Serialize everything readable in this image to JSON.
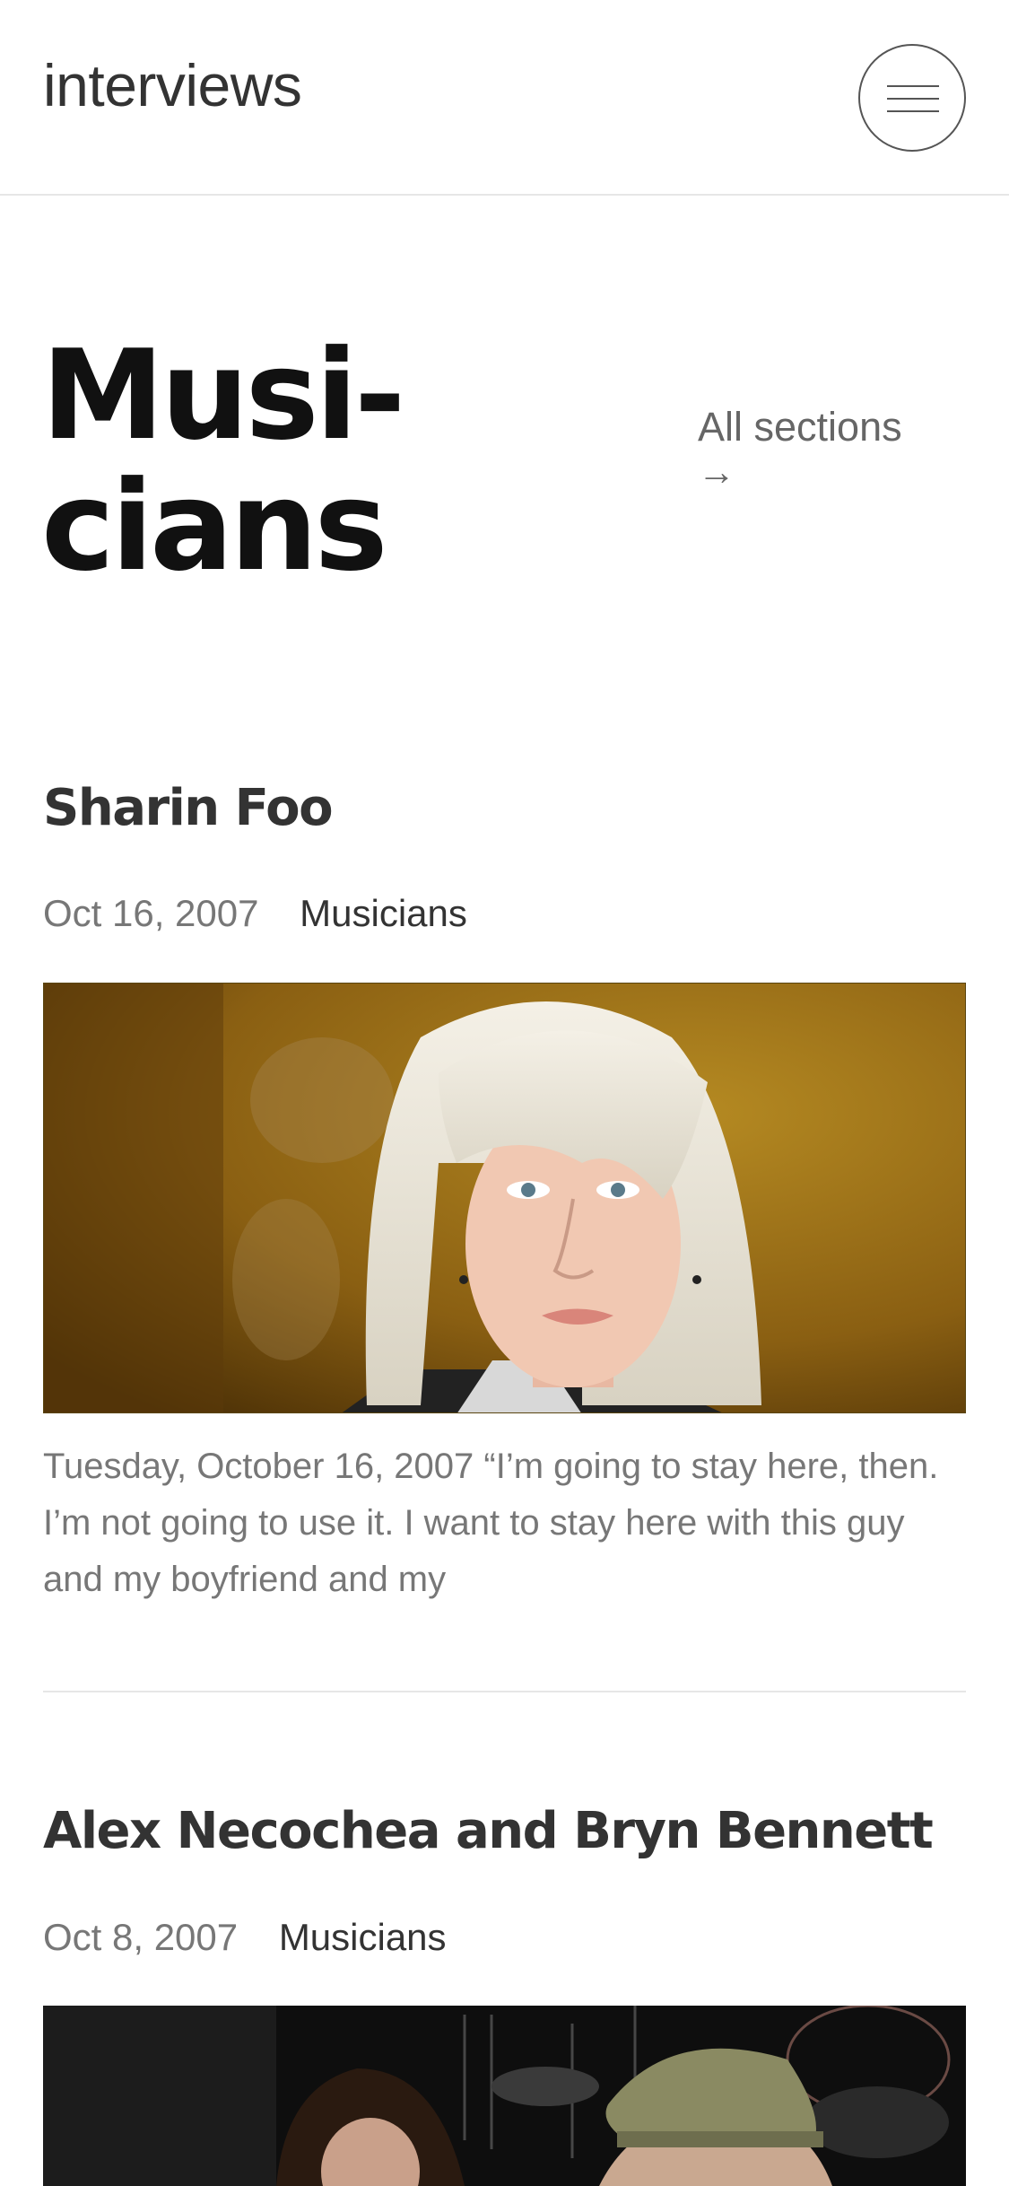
{
  "header": {
    "site_title": "interviews",
    "menu_icon": "hamburger-icon"
  },
  "section": {
    "title_line1": "Musi-",
    "title_line2": "cians",
    "all_sections_label": "All sections",
    "all_sections_arrow": "→"
  },
  "posts": [
    {
      "title": "Sharin Foo",
      "date": "Oct 16, 2007",
      "category": "Musicians",
      "excerpt": "Tuesday, October 16, 2007 “I’m going to stay here, then. I’m not going to use it. I want to stay here with this guy and my boyfriend and my"
    },
    {
      "title": "Alex Necochea and Bryn Bennett",
      "date": "Oct 8, 2007",
      "category": "Musicians"
    }
  ],
  "colors": {
    "text_dark": "#111111",
    "text_muted": "#777777",
    "divider": "#e6e6e6"
  }
}
